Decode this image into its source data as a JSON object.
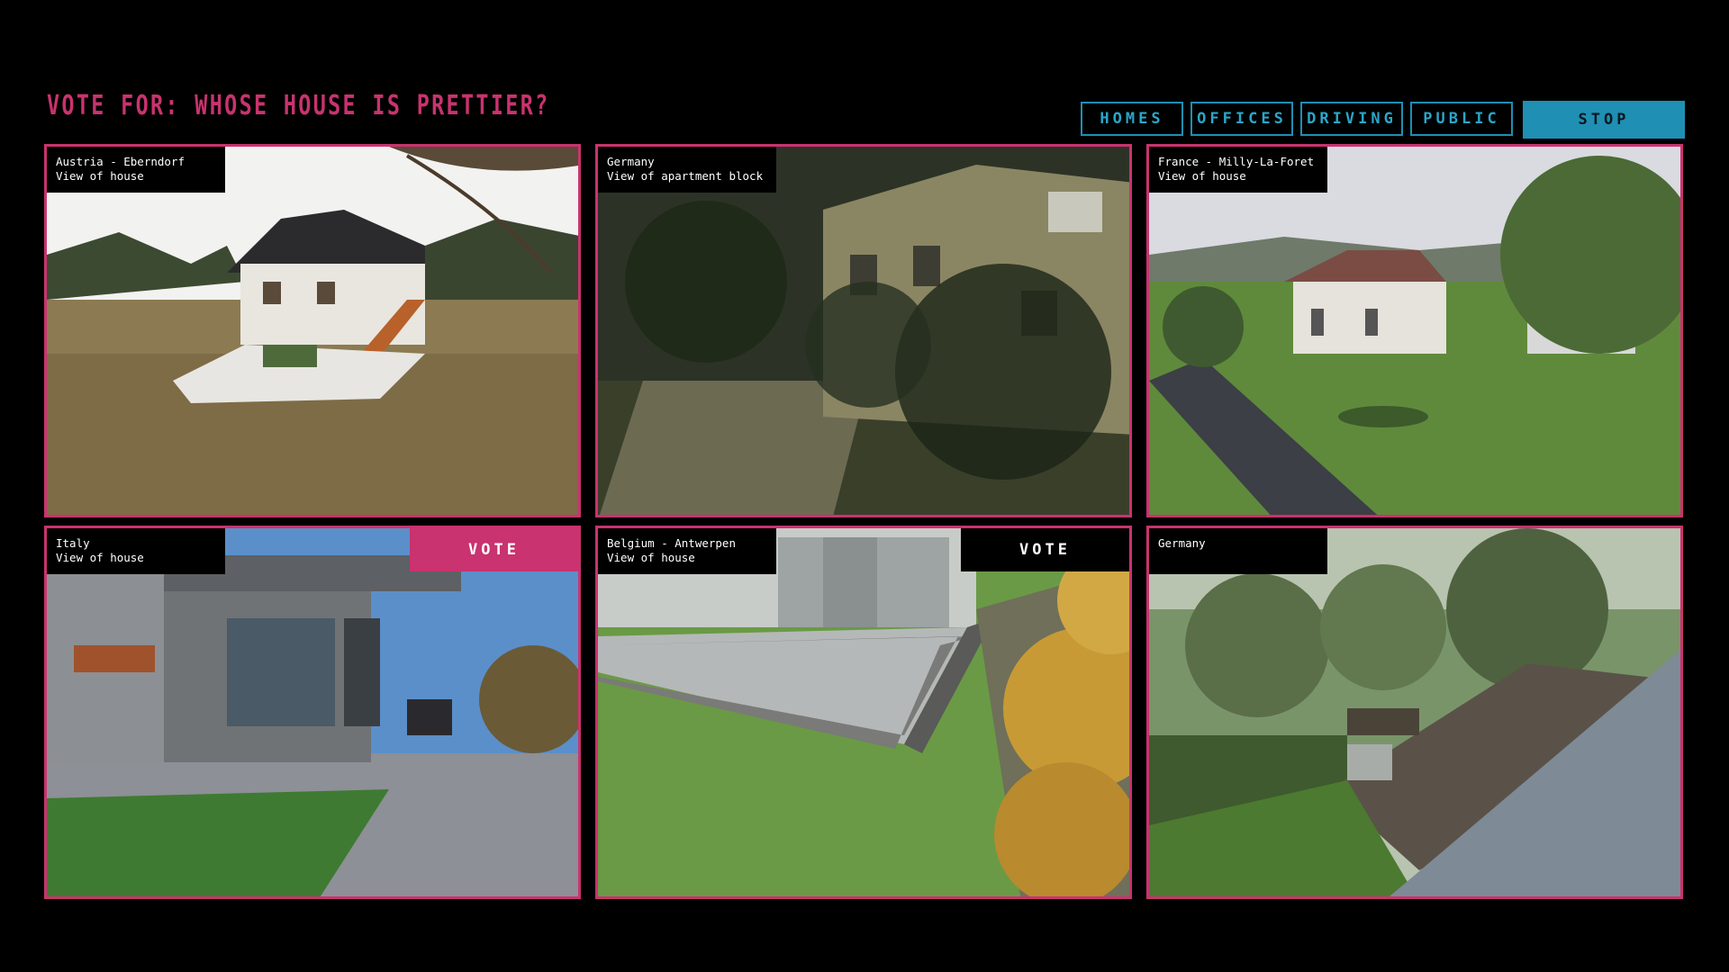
{
  "header": {
    "title": "VOTE FOR: WHOSE HOUSE IS PRETTIER?"
  },
  "nav": {
    "homes": "HOMES",
    "offices": "OFFICES",
    "driving": "DRIVING",
    "public": "PUBLIC",
    "stop": "STOP"
  },
  "colors": {
    "accent": "#c9336f",
    "nav": "#1f8fb3"
  },
  "cameras": [
    {
      "place": "Austria - Eberndorf",
      "view": "View of house"
    },
    {
      "place": "Germany",
      "view": "View of apartment block"
    },
    {
      "place": "France - Milly-La-Foret",
      "view": "View of house"
    },
    {
      "place": "Italy",
      "view": "View of house",
      "vote": "VOTE"
    },
    {
      "place": "Belgium - Antwerpen",
      "view": "View of house",
      "vote": "VOTE"
    },
    {
      "place": "Germany",
      "view": ""
    }
  ]
}
